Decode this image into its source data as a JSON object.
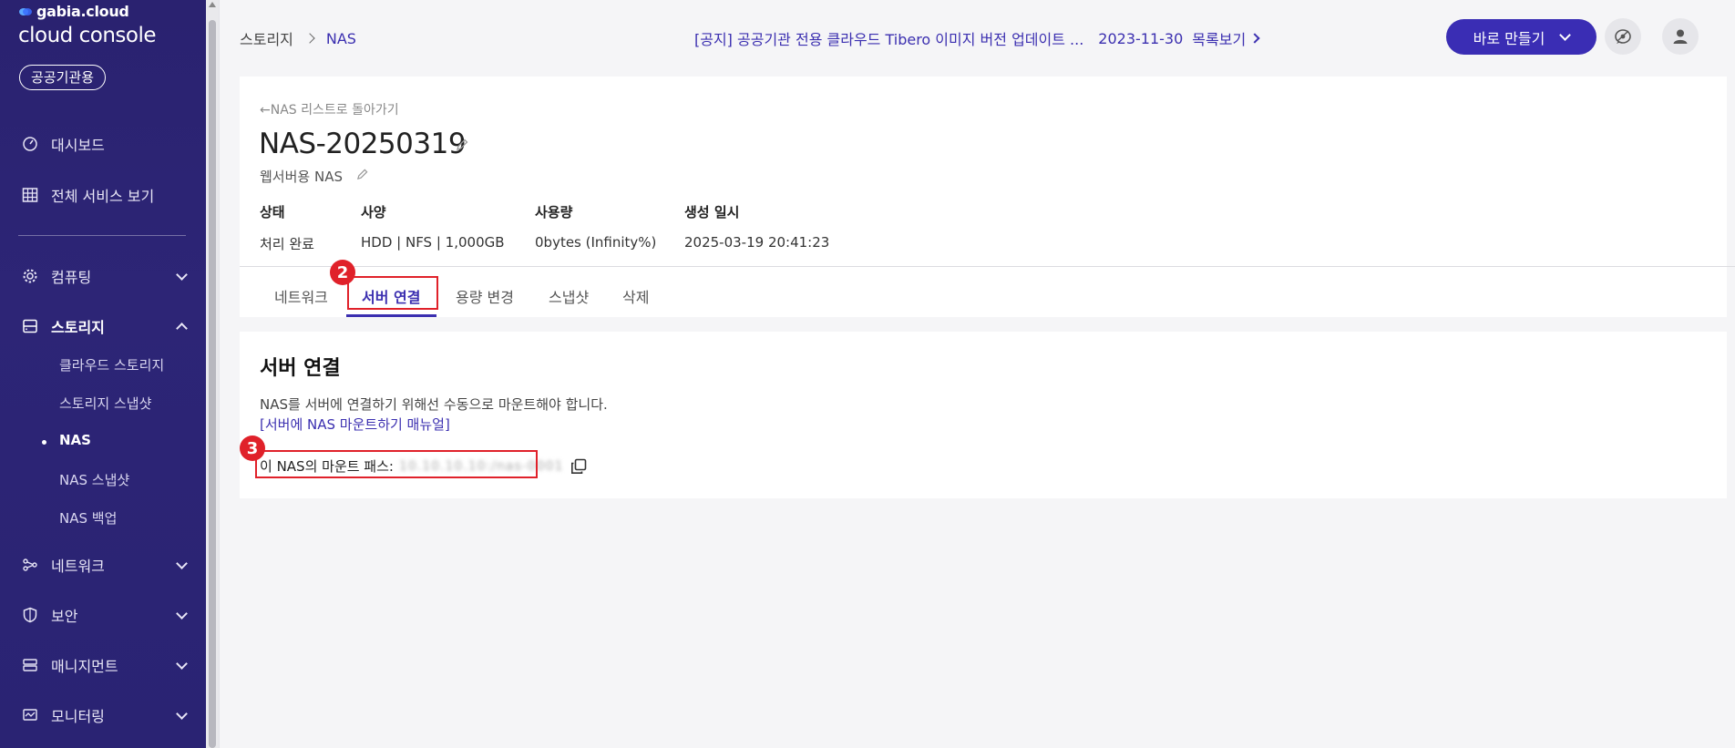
{
  "sidebar": {
    "brand_small": "gabia.cloud",
    "brand_big": "cloud console",
    "badge": "공공기관용",
    "nav": [
      {
        "label": "대시보드",
        "icon": "dashboard-icon"
      },
      {
        "label": "전체 서비스 보기",
        "icon": "grid-icon"
      },
      {
        "label": "컴퓨팅",
        "icon": "gear-icon"
      },
      {
        "label": "스토리지",
        "icon": "storage-icon"
      },
      {
        "label": "네트워크",
        "icon": "network-icon"
      },
      {
        "label": "보안",
        "icon": "shield-icon"
      },
      {
        "label": "매니지먼트",
        "icon": "management-icon"
      },
      {
        "label": "모니터링",
        "icon": "monitor-icon"
      }
    ],
    "storage_sub": [
      "클라우드 스토리지",
      "스토리지 스냅샷",
      "NAS",
      "NAS 스냅샷",
      "NAS 백업"
    ]
  },
  "header": {
    "breadcrumb": [
      "스토리지",
      "NAS"
    ],
    "notice_text": "[공지] 공공기관 전용 클라우드 Tibero 이미지 버전 업데이트 ...",
    "notice_date": "2023-11-30",
    "notice_list": "목록보기",
    "create_label": "바로 만들기"
  },
  "detail": {
    "back_label": "NAS 리스트로 돌아가기",
    "title": "NAS-20250319",
    "description": "웹서버용 NAS",
    "info": [
      {
        "label": "상태",
        "value": "처리 완료"
      },
      {
        "label": "사양",
        "value": "HDD | NFS | 1,000GB"
      },
      {
        "label": "사용량",
        "value": "0bytes (Infinity%)"
      },
      {
        "label": "생성 일시",
        "value": "2025-03-19 20:41:23"
      }
    ],
    "tabs": [
      "네트워크",
      "서버 연결",
      "용량 변경",
      "스냅샷",
      "삭제"
    ],
    "active_tab": "서버 연결"
  },
  "server_connect": {
    "title": "서버 연결",
    "description": "NAS를 서버에 연결하기 위해선 수동으로 마운트해야 합니다.",
    "manual_link": "[서버에 NAS 마운트하기 매뉴얼]",
    "mount_label": "이 NAS의 마운트 패스:",
    "mount_value": "10.10.10.10:/nas-0001"
  },
  "annotations": {
    "step2": "2",
    "step3": "3"
  },
  "colors": {
    "sidebar": "#2a2270",
    "accent": "#3b2fb0",
    "highlight": "#e0212a"
  }
}
